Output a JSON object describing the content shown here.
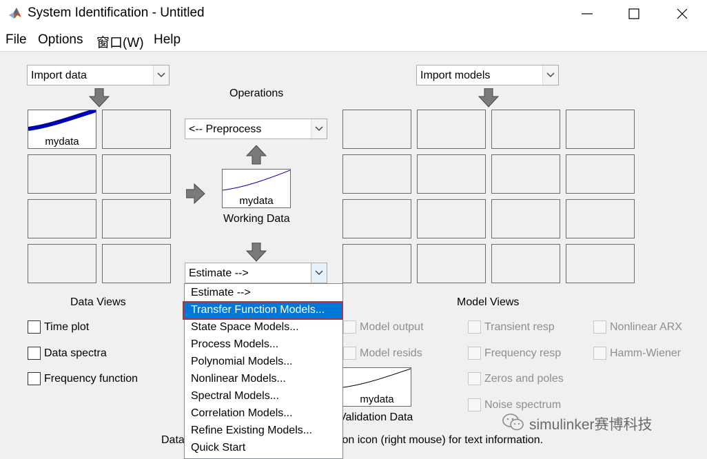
{
  "window": {
    "title": "System Identification - Untitled",
    "icon": "matlab-icon",
    "controls": [
      "minimize-icon",
      "maximize-icon",
      "close-icon"
    ]
  },
  "menubar": {
    "items": [
      "File",
      "Options",
      "窗口(W)",
      "Help"
    ]
  },
  "data_panel": {
    "import_select_value": "Import data",
    "slot1_label": "mydata",
    "views_label": "Data Views",
    "checkboxes": [
      "Time plot",
      "Data spectra",
      "Frequency function"
    ]
  },
  "operations": {
    "label": "Operations",
    "preprocess_value": "<-- Preprocess",
    "working_data_slot_label": "mydata",
    "working_data_label": "Working Data",
    "estimate_value": "Estimate -->"
  },
  "estimate_menu": {
    "items": [
      "Estimate -->",
      "Transfer Function Models...",
      "State Space Models...",
      "Process Models...",
      "Polynomial Models...",
      "Nonlinear Models...",
      "Spectral Models...",
      "Correlation Models...",
      "Refine Existing Models...",
      "Quick Start"
    ],
    "highlighted_index": 1
  },
  "models_panel": {
    "import_select_value": "Import models",
    "views_label": "Model Views",
    "checkboxes_col1": [
      "Model output",
      "Model resids"
    ],
    "checkboxes_col2": [
      "Transient resp",
      "Frequency resp",
      "Zeros and poles",
      "Noise spectrum"
    ],
    "checkboxes_col3": [
      "Nonlinear ARX",
      "Hamm-Wiener"
    ],
    "validation_slot_label": "mydata",
    "validation_label": "Validation Data"
  },
  "status_bar": {
    "left_text": "Data",
    "right_text": "k on icon (right mouse) for text information."
  },
  "watermark": {
    "text": "simulinker赛博科技",
    "icon": "wechat-icon"
  },
  "colors": {
    "accent_highlight": "#0078d7",
    "highlight_border": "#a3364b",
    "signal_line": "#0000b4"
  }
}
